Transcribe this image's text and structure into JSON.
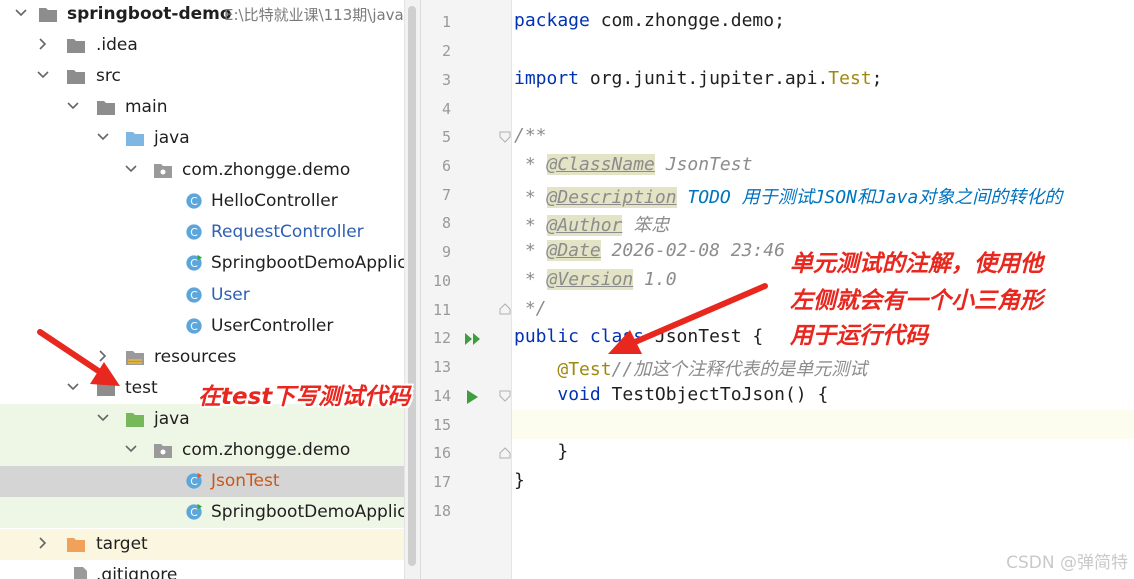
{
  "tree": {
    "items": [
      {
        "label": "springboot-demo",
        "path": "E:\\比特就业课\\113期\\java"
      },
      {
        "label": ".idea"
      },
      {
        "label": "src"
      },
      {
        "label": "main"
      },
      {
        "label": "java"
      },
      {
        "label": "com.zhongge.demo"
      },
      {
        "label": "HelloController"
      },
      {
        "label": "RequestController"
      },
      {
        "label": "SpringbootDemoApplicat"
      },
      {
        "label": "User"
      },
      {
        "label": "UserController"
      },
      {
        "label": "resources"
      },
      {
        "label": "test"
      },
      {
        "label": "java"
      },
      {
        "label": "com.zhongge.demo"
      },
      {
        "label": "JsonTest"
      },
      {
        "label": "SpringbootDemoApplicat"
      },
      {
        "label": "target"
      },
      {
        "label": ".gitignore"
      }
    ]
  },
  "editor": {
    "line_numbers": [
      "1",
      "2",
      "3",
      "4",
      "5",
      "6",
      "7",
      "8",
      "9",
      "10",
      "11",
      "12",
      "13",
      "14",
      "15",
      "16",
      "17",
      "18"
    ],
    "code": {
      "l1_kw": "package",
      "l1_rest": " com.zhongge.demo;",
      "l3_kw": "import",
      "l3_rest": " org.junit.jupiter.api.",
      "l3_ann": "Test",
      "l3_end": ";",
      "l5": "/**",
      "l6_pre": " * ",
      "l6_tag": "@ClassName",
      "l6_val": " JsonTest",
      "l7_pre": " * ",
      "l7_tag": "@Description",
      "l7_sp": " ",
      "l7_todo": "TODO 用于测试JSON和Java对象之间的转化的",
      "l8_pre": " * ",
      "l8_tag": "@Author",
      "l8_val": " 笨忠",
      "l9_pre": " * ",
      "l9_tag": "@Date",
      "l9_val": " 2026-02-08 23:46",
      "l10_pre": " * ",
      "l10_tag": "@Version",
      "l10_val": " 1.0",
      "l11": " */",
      "l12_kw": "public class",
      "l12_rest": " JsonTest {",
      "l13_ind": "    ",
      "l13_ann": "@Test",
      "l13_cmt": "//加这个注释代表的是单元测试",
      "l14_ind": "    ",
      "l14_kw": "void",
      "l14_rest": " TestObjectToJson() {",
      "l16": "    }",
      "l17": "}"
    }
  },
  "annotations": {
    "note_test": "在test下写测试代码",
    "note_run_1": "单元测试的注解，使用他",
    "note_run_2": "左侧就会有一个小三角形",
    "note_run_3": "用于运行代码"
  },
  "watermark": "CSDN @弹简特",
  "colors": {
    "annotation_red": "#e8271f",
    "keyword": "#0033b3",
    "annotation": "#9e880d",
    "test_bg": "#eef6e6"
  }
}
